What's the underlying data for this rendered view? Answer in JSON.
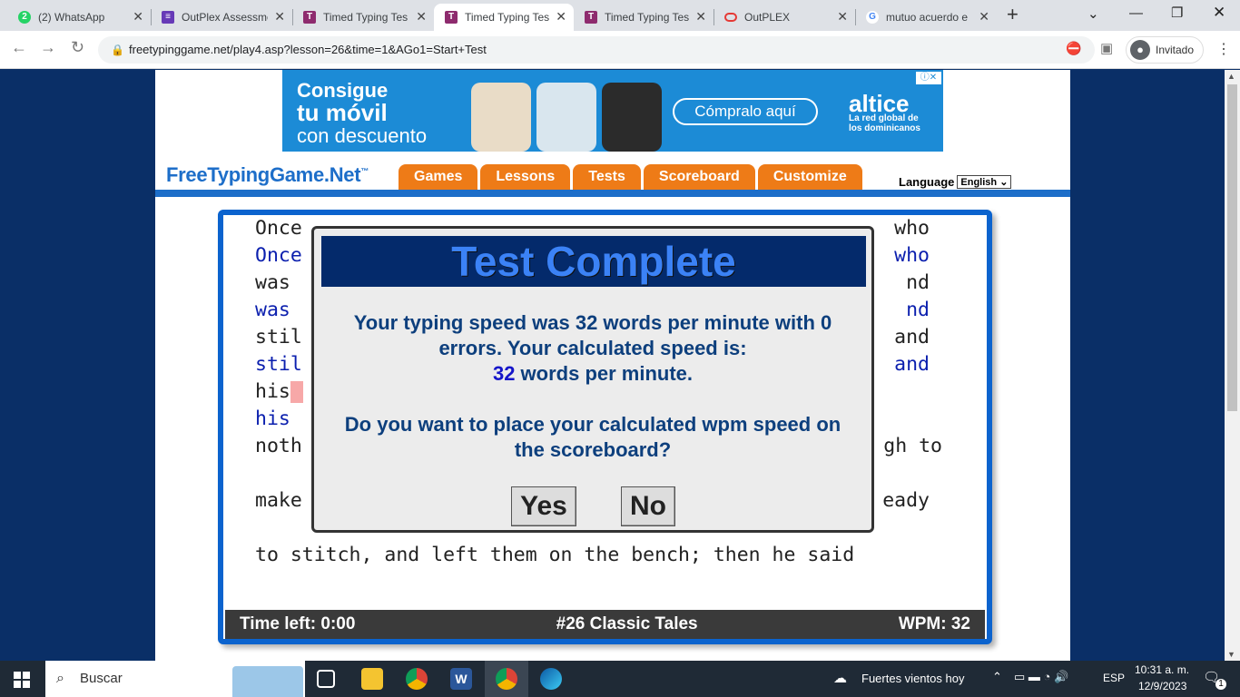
{
  "tabs": [
    {
      "label": "(2) WhatsApp",
      "icon": "whatsapp-icon",
      "color": "#25d366"
    },
    {
      "label": "OutPlex Assessme",
      "icon": "forms-icon",
      "color": "#673ab7"
    },
    {
      "label": "Timed Typing Tes",
      "icon": "t-icon",
      "color": "#8e2b6e"
    },
    {
      "label": "Timed Typing Tes",
      "icon": "t-icon",
      "color": "#8e2b6e",
      "active": true
    },
    {
      "label": "Timed Typing Tes",
      "icon": "t-icon",
      "color": "#8e2b6e"
    },
    {
      "label": "OutPLEX",
      "icon": "outplex-icon",
      "color": "#e53935"
    },
    {
      "label": "mutuo acuerdo e",
      "icon": "google-icon",
      "color": "#4285f4"
    }
  ],
  "address": {
    "url": "freetypinggame.net/play4.asp?lesson=26&time=1&AGo1=Start+Test",
    "profile": "Invitado"
  },
  "ad": {
    "line1": "Consigue",
    "line2": "tu móvil",
    "line3": "con descuento",
    "button": "Cómpralo aquí",
    "brand": "altice",
    "brand_sub": "La red global de los dominicanos"
  },
  "site": {
    "logo": "FreeTypingGame.Net",
    "logo_tm": "™",
    "menu": [
      "Games",
      "Lessons",
      "Tests",
      "Scoreboard",
      "Customize"
    ],
    "language_label": "Language",
    "language_value": "English"
  },
  "typing": {
    "lines": [
      {
        "text": "Once",
        "right": "who",
        "typed": false
      },
      {
        "text": "Once",
        "right": "who",
        "typed": true
      },
      {
        "text": "was",
        "right": "nd",
        "typed": false
      },
      {
        "text": "was",
        "right": "nd",
        "typed": true
      },
      {
        "text": "stil",
        "right": "and",
        "typed": false
      },
      {
        "text": "stil",
        "right": "and",
        "typed": true
      },
      {
        "text": "his",
        "right": "",
        "typed": false,
        "cursor": true
      },
      {
        "text": "his",
        "right": "",
        "typed": true
      },
      {
        "text": "noth",
        "right": "gh to",
        "typed": false
      },
      {
        "text": "make",
        "right": "eady",
        "typed": false
      },
      {
        "text": "to stitch, and left them on the bench; then he said",
        "right": "",
        "typed": false
      }
    ],
    "status": {
      "time_left": "Time left: 0:00",
      "lesson": "#26 Classic Tales",
      "wpm": "WPM: 32"
    }
  },
  "modal": {
    "title": "Test Complete",
    "line1": "Your typing speed was 32 words per minute with 0",
    "line2": "errors. Your calculated speed is:",
    "speed_value": "32",
    "speed_suffix": " words per minute.",
    "question1": "Do you want to place your calculated wpm speed on",
    "question2": "the scoreboard?",
    "yes": "Yes",
    "no": "No"
  },
  "taskbar": {
    "search": "Buscar",
    "weather": "Fuertes vientos hoy",
    "lang": "ESP",
    "time": "10:31 a. m.",
    "date": "12/9/2023",
    "notifications": "1"
  }
}
